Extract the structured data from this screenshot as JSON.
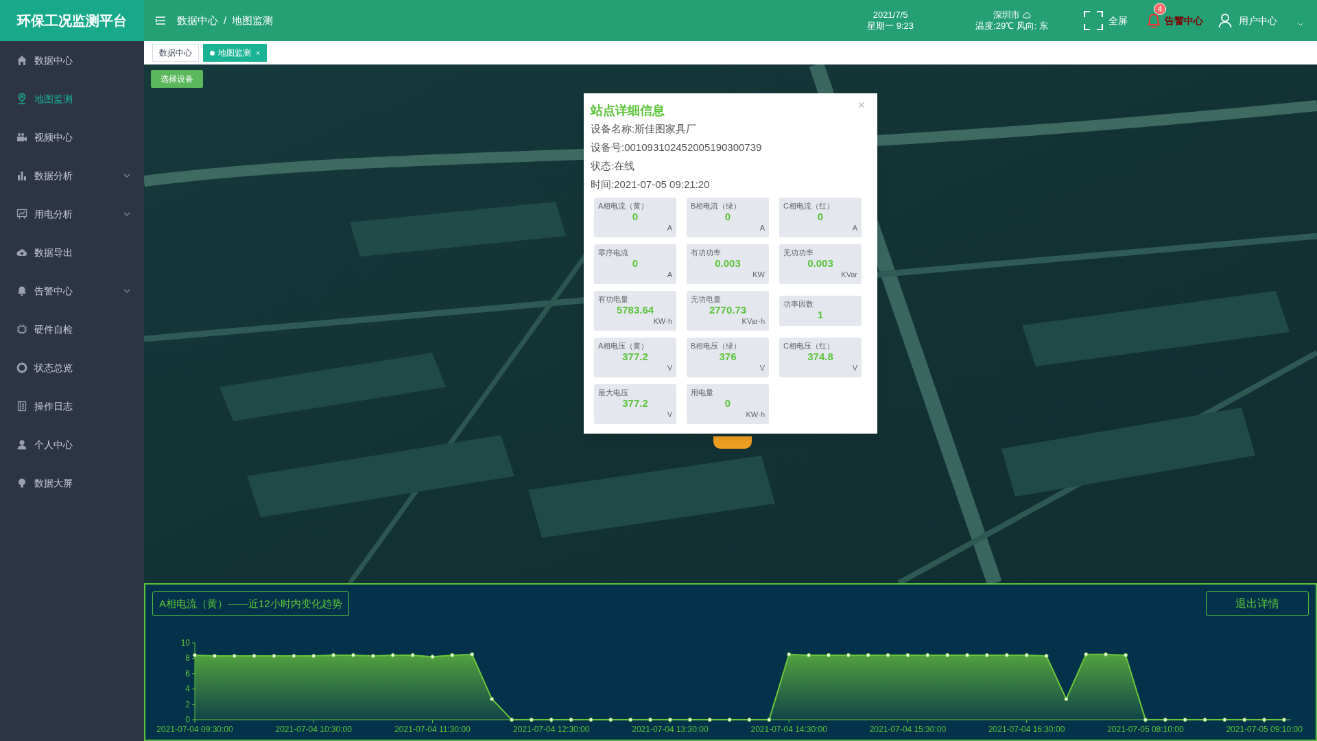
{
  "app": {
    "title": "环保工况监测平台"
  },
  "sidebar": {
    "items": [
      {
        "label": "数据中心",
        "selected": false,
        "kind": "link"
      },
      {
        "label": "地图监测",
        "selected": true,
        "kind": "link"
      },
      {
        "label": "视频中心",
        "selected": false,
        "kind": "link"
      },
      {
        "label": "数据分析",
        "selected": false,
        "kind": "group",
        "expanded": false
      },
      {
        "label": "用电分析",
        "selected": false,
        "kind": "group",
        "expanded": false
      },
      {
        "label": "数据导出",
        "selected": false,
        "kind": "link"
      },
      {
        "label": "告警中心",
        "selected": false,
        "kind": "group",
        "expanded": false
      },
      {
        "label": "硬件自检",
        "selected": false,
        "kind": "link"
      },
      {
        "label": "状态总览",
        "selected": false,
        "kind": "link"
      },
      {
        "label": "操作日志",
        "selected": false,
        "kind": "link"
      },
      {
        "label": "个人中心",
        "selected": false,
        "kind": "link"
      },
      {
        "label": "数据大屏",
        "selected": false,
        "kind": "link"
      }
    ]
  },
  "header": {
    "breadcrumb": {
      "items": [
        "数据中心",
        "地图监测"
      ],
      "separator": "/"
    },
    "date": "2021/7/5",
    "weekday_time": "星期一 9:23",
    "city": "深圳市",
    "weather": "温度:29℃ 风向: 东",
    "fullscreen": "全屏",
    "alerts": {
      "label": "告警中心",
      "badge": "4"
    },
    "user": "用户中心"
  },
  "tabs": [
    {
      "label": "数据中心",
      "selected": false,
      "closable": false
    },
    {
      "label": "地图监测",
      "selected": true,
      "closable": true,
      "close": "×"
    }
  ],
  "map": {
    "select_button": "选择设备"
  },
  "popup": {
    "title": "站点详细信息",
    "close": "×",
    "fields": [
      "设备名称:斯佳图家具厂",
      "设备号:001093102452005190300739",
      "状态:在线",
      "时间:2021-07-05 09:21:20"
    ],
    "cards": [
      {
        "label": "A相电流（黄）",
        "value": "0",
        "unit": "A"
      },
      {
        "label": "B相电流（绿）",
        "value": "0",
        "unit": "A"
      },
      {
        "label": "C相电流（红）",
        "value": "0",
        "unit": "A"
      },
      {
        "label": "零序电流",
        "value": "0",
        "unit": "A"
      },
      {
        "label": "有功功率",
        "value": "0.003",
        "unit": "KW"
      },
      {
        "label": "无功功率",
        "value": "0.003",
        "unit": "KVar"
      },
      {
        "label": "有功电量",
        "value": "5783.64",
        "unit": "KW·h"
      },
      {
        "label": "无功电量",
        "value": "2770.73",
        "unit": "KVar·h"
      },
      {
        "label": "功率因数",
        "value": "1"
      },
      {
        "label": "A相电压（黄）",
        "value": "377.2",
        "unit": "V"
      },
      {
        "label": "B相电压（绿）",
        "value": "376",
        "unit": "V"
      },
      {
        "label": "C相电压（红）",
        "value": "374.8",
        "unit": "V"
      },
      {
        "label": "最大电压",
        "value": "377.2",
        "unit": "V"
      },
      {
        "label": "用电量",
        "value": "0",
        "unit": "KW·h"
      }
    ]
  },
  "chart_panel": {
    "title": "A相电流（黄）——近12小时内变化趋势",
    "exit_button": "退出详情",
    "chart_data": {
      "type": "area",
      "categories": [
        "2021-07-04 09:30:00",
        null,
        null,
        null,
        null,
        null,
        "2021-07-04 10:30:00",
        null,
        null,
        null,
        null,
        null,
        "2021-07-04 11:30:00",
        null,
        null,
        null,
        null,
        null,
        "2021-07-04 12:30:00",
        null,
        null,
        null,
        null,
        null,
        "2021-07-04 13:30:00",
        null,
        null,
        null,
        null,
        null,
        "2021-07-04 14:30:00",
        null,
        null,
        null,
        null,
        null,
        "2021-07-04 15:30:00",
        null,
        null,
        null,
        null,
        null,
        "2021-07-04 16:30:00",
        null,
        null,
        null,
        null,
        null,
        "2021-07-05 08:10:00",
        null,
        null,
        null,
        null,
        null,
        "2021-07-05 09:10:00",
        null
      ],
      "series": [
        {
          "color": "#6cc63a",
          "values": [
            8.4,
            8.3,
            8.3,
            8.3,
            8.3,
            8.3,
            8.3,
            8.4,
            8.4,
            8.3,
            8.4,
            8.4,
            8.2,
            8.4,
            8.5,
            2.7,
            0,
            0,
            0,
            0,
            0,
            0,
            0,
            0,
            0,
            0,
            0,
            0,
            0,
            0,
            8.5,
            8.4,
            8.4,
            8.4,
            8.4,
            8.4,
            8.4,
            8.4,
            8.4,
            8.4,
            8.4,
            8.4,
            8.4,
            8.3,
            2.7,
            8.5,
            8.5,
            8.4,
            0,
            0,
            0,
            0,
            0,
            0,
            0,
            0
          ]
        }
      ],
      "ylim": [
        0,
        10
      ],
      "yticks": [
        0,
        2,
        4,
        6,
        8,
        10
      ]
    }
  }
}
